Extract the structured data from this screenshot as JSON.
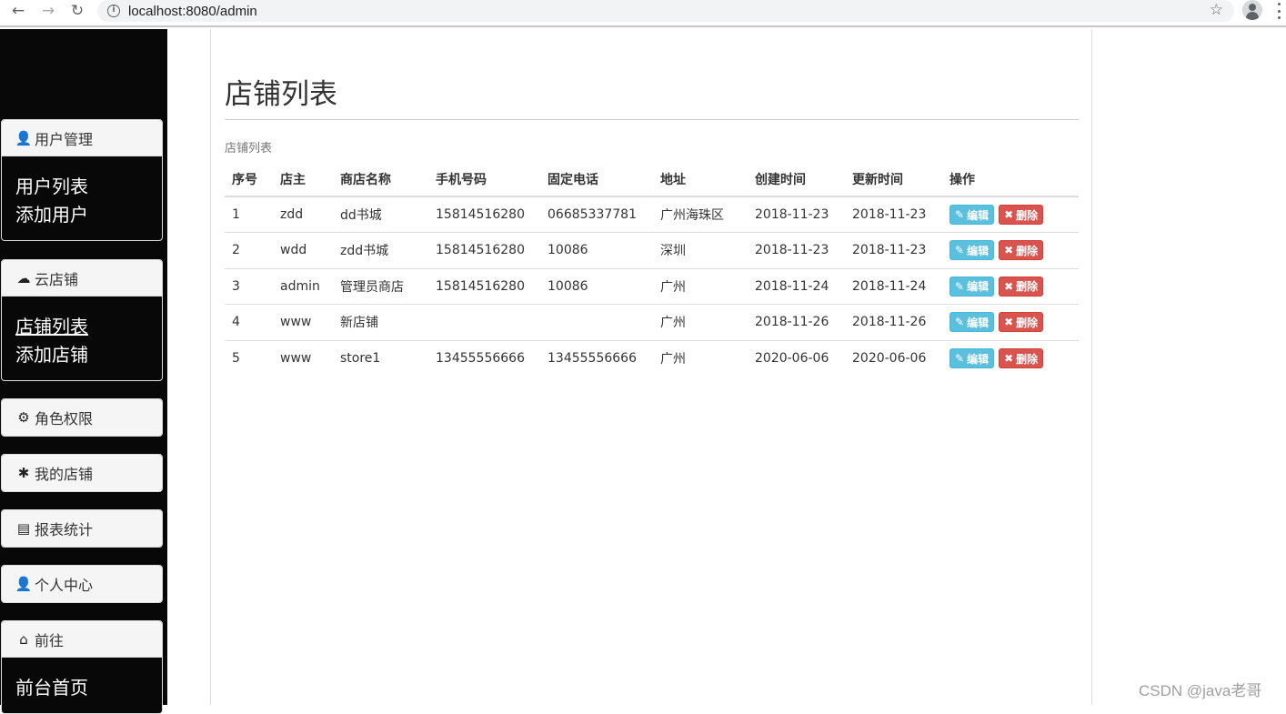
{
  "browser": {
    "url": "localhost:8080/admin",
    "back_icon": "←",
    "forward_icon": "→",
    "reload_icon": "↻",
    "info_icon": "i",
    "star_icon": "☆"
  },
  "sidebar": {
    "panels": [
      {
        "title": "用户管理",
        "icon": "user-icon",
        "glyph": "👤",
        "links": [
          {
            "label": "用户列表",
            "active": false
          },
          {
            "label": "添加用户",
            "active": false
          }
        ]
      },
      {
        "title": "云店铺",
        "icon": "cloud-icon",
        "glyph": "☁",
        "links": [
          {
            "label": "店铺列表",
            "active": true
          },
          {
            "label": "添加店铺",
            "active": false
          }
        ]
      },
      {
        "title": "角色权限",
        "icon": "cog-icon",
        "glyph": "⚙",
        "links": []
      },
      {
        "title": "我的店铺",
        "icon": "asterisk-icon",
        "glyph": "✱",
        "links": []
      },
      {
        "title": "报表统计",
        "icon": "list-alt-icon",
        "glyph": "▤",
        "links": []
      },
      {
        "title": "个人中心",
        "icon": "user-icon",
        "glyph": "👤",
        "links": []
      },
      {
        "title": "前往",
        "icon": "home-icon",
        "glyph": "⌂",
        "links": [
          {
            "label": "前台首页",
            "active": false
          }
        ]
      }
    ]
  },
  "main": {
    "title": "店铺列表",
    "caption": "店铺列表",
    "columns": [
      "序号",
      "店主",
      "商店名称",
      "手机号码",
      "固定电话",
      "地址",
      "创建时间",
      "更新时间",
      "操作"
    ],
    "rows": [
      [
        "1",
        "zdd",
        "dd书城",
        "15814516280",
        "06685337781",
        "广州海珠区",
        "2018-11-23",
        "2018-11-23"
      ],
      [
        "2",
        "wdd",
        "zdd书城",
        "15814516280",
        "10086",
        "深圳",
        "2018-11-23",
        "2018-11-23"
      ],
      [
        "3",
        "admin",
        "管理员商店",
        "15814516280",
        "10086",
        "广州",
        "2018-11-24",
        "2018-11-24"
      ],
      [
        "4",
        "www",
        "新店铺",
        "",
        "",
        "广州",
        "2018-11-26",
        "2018-11-26"
      ],
      [
        "5",
        "www",
        "store1",
        "13455556666",
        "13455556666",
        "广州",
        "2020-06-06",
        "2020-06-06"
      ]
    ],
    "edit_label": "编辑",
    "delete_label": "删除",
    "edit_glyph": "✎",
    "delete_glyph": "✖"
  },
  "colors": {
    "sidebar_bg": "#080808",
    "edit_btn": "#5bc0de",
    "delete_btn": "#d9534f"
  },
  "watermark": "CSDN @java老哥"
}
